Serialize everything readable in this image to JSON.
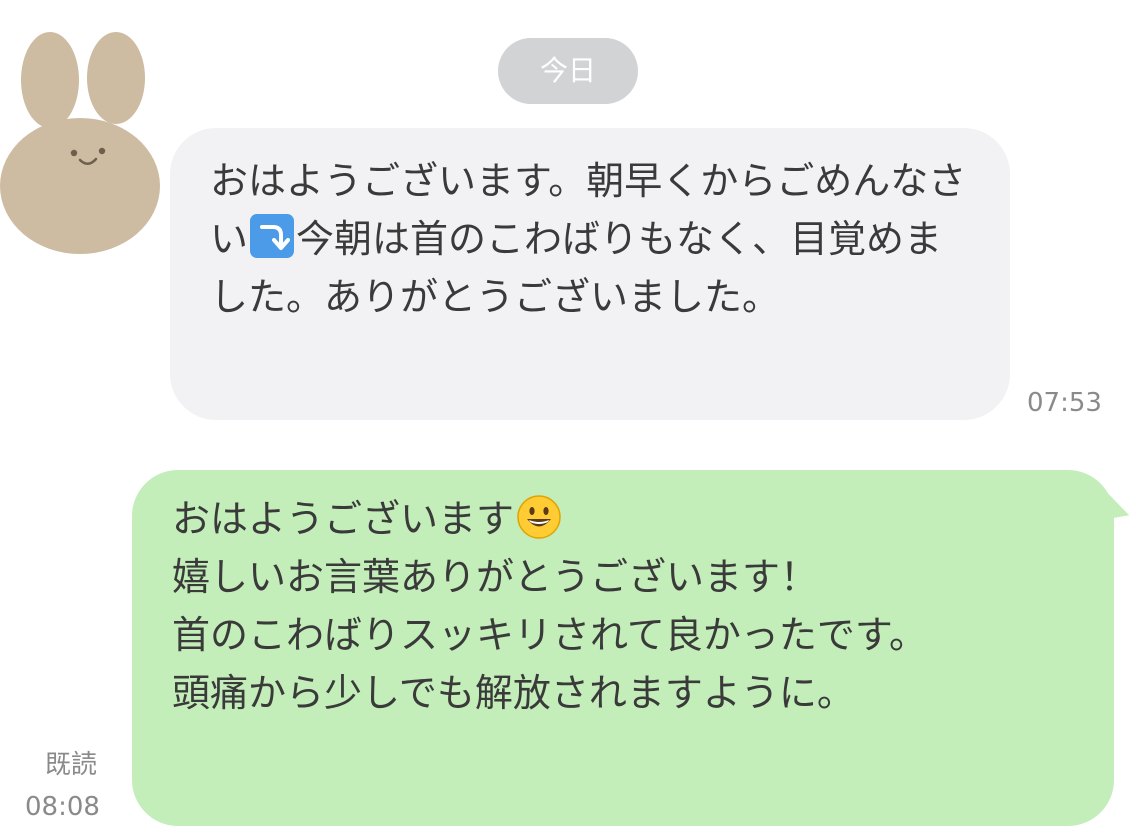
{
  "date_separator": "今日",
  "incoming_message": {
    "text_part1": "おはようございます。朝早くからごめんなさい",
    "emoji": "arrow-curving-down-icon",
    "text_part2": "今朝は首のこわばりもなく、目覚めました。ありがとうございました。",
    "time": "07:53"
  },
  "outgoing_message": {
    "line1": "おはようございます",
    "emoji": "grinning-face-icon",
    "line2": "嬉しいお言葉ありがとうございます！",
    "line3": "首のこわばりスッキリされて良かったです。",
    "line4": "頭痛から少しでも解放されますように。",
    "read_label": "既読",
    "time": "08:08"
  },
  "colors": {
    "incoming_bubble": "#f2f2f4",
    "outgoing_bubble": "#c3edb9",
    "date_pill": "#d2d3d4",
    "avatar": "#cdbba2"
  }
}
